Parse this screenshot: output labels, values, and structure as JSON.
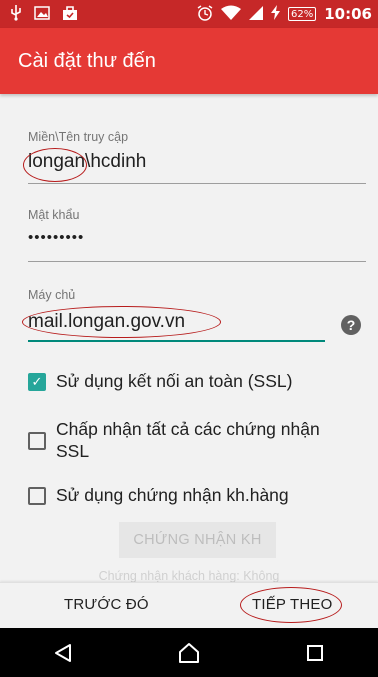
{
  "status_bar": {
    "time": "10:06",
    "battery": "62%",
    "icons": [
      "usb-icon",
      "image-icon",
      "bag-icon",
      "alarm-icon",
      "wifi-icon",
      "signal-icon",
      "charging-icon"
    ]
  },
  "app_bar": {
    "title": "Cài đặt thư đến"
  },
  "form": {
    "username": {
      "label": "Miền\\Tên truy cập",
      "value": "longan\\hcdinh"
    },
    "password": {
      "label": "Mật khẩu",
      "value": "•••••••••"
    },
    "server": {
      "label": "Máy chủ",
      "value": "mail.longan.gov.vn",
      "help_icon": "?"
    }
  },
  "options": [
    {
      "label": "Sử dụng kết nối an toàn (SSL)",
      "checked": true
    },
    {
      "label_line1": "Chấp nhận tất cả các chứng nhận",
      "label_line2": "SSL",
      "checked": false
    },
    {
      "label": "Sử dụng chứng nhận kh.hàng",
      "checked": false
    }
  ],
  "cert_button": {
    "label": "CHỨNG NHẬN KH"
  },
  "cert_status": "Chứng nhận khách hàng: Không",
  "actions": {
    "previous": "TRƯỚC ĐÓ",
    "next": "TIẾP THEO"
  },
  "colors": {
    "status_bar": "#c62828",
    "app_bar": "#e53935",
    "accent": "#26a69a",
    "annotation": "#b71c1c"
  }
}
